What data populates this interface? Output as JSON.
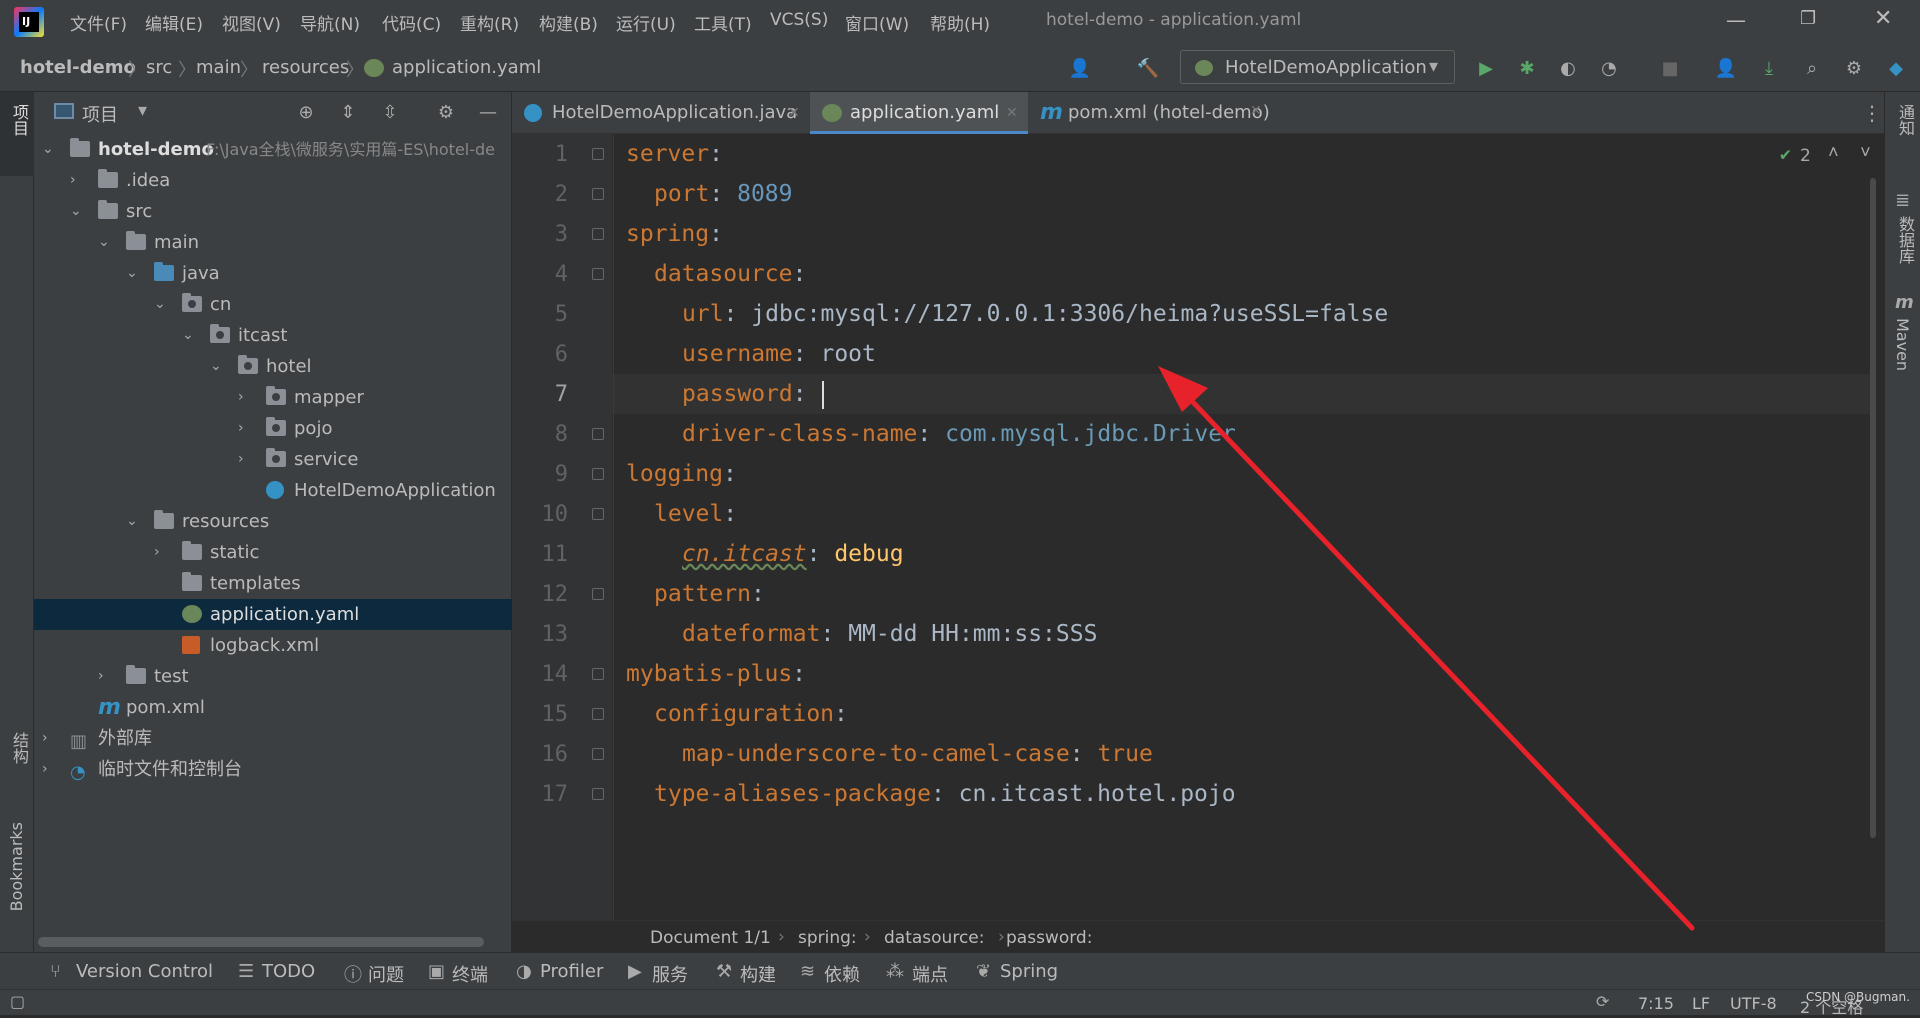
{
  "title_bar": {
    "menus": [
      "文件(F)",
      "编辑(E)",
      "视图(V)",
      "导航(N)",
      "代码(C)",
      "重构(R)",
      "构建(B)",
      "运行(U)",
      "工具(T)",
      "VCS(S)",
      "窗口(W)",
      "帮助(H)"
    ],
    "window_title": "hotel-demo - application.yaml"
  },
  "nav_bar": {
    "breadcrumbs": [
      "hotel-demo",
      "src",
      "main",
      "resources",
      "application.yaml"
    ],
    "run_config": "HotelDemoApplication"
  },
  "left_strip": {
    "project_label": "项目",
    "structure_label": "结构",
    "bookmarks_label": "Bookmarks"
  },
  "right_strip": {
    "notifications_label": "通知",
    "database_label": "数据库",
    "maven_label": "Maven"
  },
  "project_panel": {
    "header": "项目",
    "root_name": "hotel-demo",
    "root_path": "F:\\Java全栈\\微服务\\实用篇-ES\\hotel-de",
    "items": [
      {
        "label": ".idea"
      },
      {
        "label": "src"
      },
      {
        "label": "main"
      },
      {
        "label": "java"
      },
      {
        "label": "cn"
      },
      {
        "label": "itcast"
      },
      {
        "label": "hotel"
      },
      {
        "label": "mapper"
      },
      {
        "label": "pojo"
      },
      {
        "label": "service"
      },
      {
        "label": "HotelDemoApplication"
      },
      {
        "label": "resources"
      },
      {
        "label": "static"
      },
      {
        "label": "templates"
      },
      {
        "label": "application.yaml"
      },
      {
        "label": "logback.xml"
      },
      {
        "label": "test"
      },
      {
        "label": "pom.xml"
      },
      {
        "label": "外部库"
      },
      {
        "label": "临时文件和控制台"
      }
    ]
  },
  "editor": {
    "tabs": [
      {
        "label": "HotelDemoApplication.java"
      },
      {
        "label": "application.yaml"
      },
      {
        "label": "pom.xml (hotel-demo)"
      }
    ],
    "inspection_count": "2",
    "line_numbers": [
      "1",
      "2",
      "3",
      "4",
      "5",
      "6",
      "7",
      "8",
      "9",
      "10",
      "11",
      "12",
      "13",
      "14",
      "15",
      "16",
      "17"
    ],
    "lines": [
      {
        "key": "server",
        "sep": ":",
        "val": ""
      },
      {
        "key": "port",
        "sep": ": ",
        "val": "8089"
      },
      {
        "key": "spring",
        "sep": ":",
        "val": ""
      },
      {
        "key": "datasource",
        "sep": ":",
        "val": ""
      },
      {
        "key": "url",
        "sep": ": ",
        "val": "jdbc:mysql://127.0.0.1:3306/heima?useSSL=false"
      },
      {
        "key": "username",
        "sep": ": ",
        "val": "root"
      },
      {
        "key": "password",
        "sep": ": ",
        "val": ""
      },
      {
        "key": "driver-class-name",
        "sep": ": ",
        "val": "com.mysql.jdbc.Driver"
      },
      {
        "key": "logging",
        "sep": ":",
        "val": ""
      },
      {
        "key": "level",
        "sep": ":",
        "val": ""
      },
      {
        "key": "cn.itcast",
        "sep": ": ",
        "val": "debug"
      },
      {
        "key": "pattern",
        "sep": ":",
        "val": ""
      },
      {
        "key": "dateformat",
        "sep": ": ",
        "val": "MM-dd HH:mm:ss:SSS"
      },
      {
        "key": "mybatis-plus",
        "sep": ":",
        "val": ""
      },
      {
        "key": "configuration",
        "sep": ":",
        "val": ""
      },
      {
        "key": "map-underscore-to-camel-case",
        "sep": ": ",
        "val": "true"
      },
      {
        "key": "type-aliases-package",
        "sep": ": ",
        "val": "cn.itcast.hotel.pojo"
      }
    ],
    "breadcrumbs": [
      "Document 1/1",
      "spring:",
      "datasource:",
      "password:"
    ]
  },
  "tool_windows": [
    "Version Control",
    "TODO",
    "问题",
    "终端",
    "Profiler",
    "服务",
    "构建",
    "依赖",
    "端点",
    "Spring"
  ],
  "status_bar": {
    "position": "7:15",
    "line_sep": "LF",
    "encoding": "UTF-8",
    "indent": "2 个空格",
    "watermark": "CSDN @Bugman."
  },
  "colors": {
    "accent": "#e8222a",
    "keyword": "#cc7832",
    "number": "#6897bb",
    "text": "#a9b7c6",
    "selection": "#0d293e"
  }
}
